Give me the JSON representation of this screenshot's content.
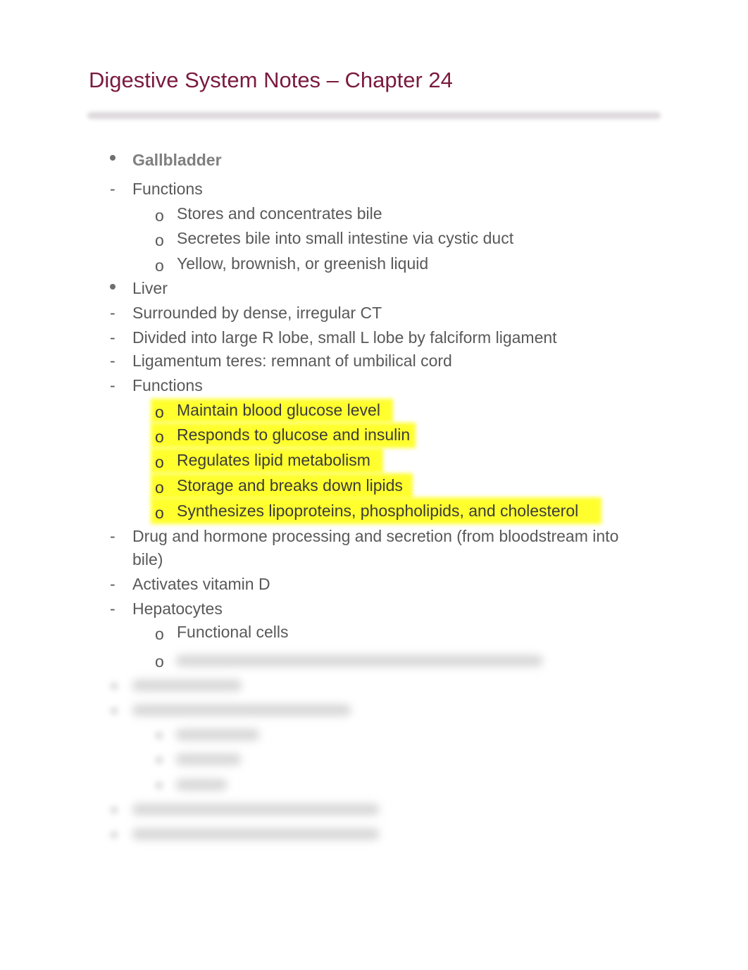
{
  "document": {
    "title": "Digestive System Notes – Chapter 24",
    "accent_color": "#7a1a3e",
    "highlight_color": "#ffff2e",
    "markers": {
      "bullet": "•",
      "dash": "-",
      "sub": "o"
    },
    "sections": {
      "gallbladder": {
        "heading": "Gallbladder",
        "functions_label": "Functions",
        "functions": [
          "Stores and concentrates bile",
          "Secretes bile into small intestine via cystic duct",
          "Yellow, brownish, or greenish liquid"
        ]
      },
      "liver": {
        "heading": "Liver",
        "points": [
          "Surrounded by dense, irregular CT",
          "Divided into large R lobe, small L lobe by falciform ligament",
          "Ligamentum teres: remnant of umbilical cord"
        ],
        "functions_label": "Functions",
        "functions_highlighted": [
          "Maintain blood glucose level",
          "Responds to glucose and insulin",
          "Regulates lipid metabolism",
          "Storage and breaks down lipids",
          "Synthesizes lipoproteins, phospholipids, and cholesterol"
        ],
        "more_points": [
          "Drug and hormone processing and secretion (from bloodstream into",
          "bile)",
          "Activates vitamin D"
        ],
        "hepatocytes_label": "Hepatocytes",
        "hepatocytes": [
          "Functional cells"
        ]
      }
    }
  }
}
